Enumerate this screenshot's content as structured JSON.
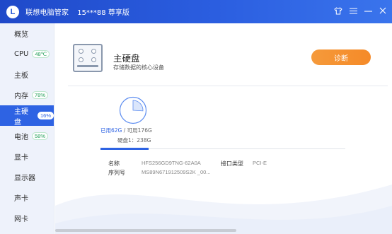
{
  "titlebar": {
    "logo_letter": "L",
    "title": "联想电脑管家",
    "user": "15***88 尊享版"
  },
  "sidebar": {
    "items": [
      {
        "label": "概览",
        "badge": ""
      },
      {
        "label": "CPU",
        "badge": "48℃"
      },
      {
        "label": "主板",
        "badge": ""
      },
      {
        "label": "内存",
        "badge": "78%"
      },
      {
        "label": "主硬盘",
        "badge": "16%",
        "active": true
      },
      {
        "label": "电池",
        "badge": "58%"
      },
      {
        "label": "显卡",
        "badge": ""
      },
      {
        "label": "显示器",
        "badge": ""
      },
      {
        "label": "声卡",
        "badge": ""
      },
      {
        "label": "网卡",
        "badge": ""
      }
    ]
  },
  "main": {
    "title": "主硬盘",
    "subtitle": "存储数据的核心设备",
    "diagnose_label": "诊断",
    "usage": {
      "used_text": "已用62G",
      "available_text": " / 可用176G",
      "disk_capacity": "硬盘1：238G",
      "used_fraction": 0.26
    },
    "info": {
      "name_label": "名称",
      "name_value": "HFS256GD9TNG-62A0A",
      "interface_label": "接口类型",
      "interface_value": "PCI-E",
      "serial_label": "序列号",
      "serial_value": "MS89N671912509S2K _00..."
    }
  },
  "colors": {
    "accent": "#2e63e3",
    "diagnose": "#f58a28",
    "badge_green": "#25a05a"
  }
}
